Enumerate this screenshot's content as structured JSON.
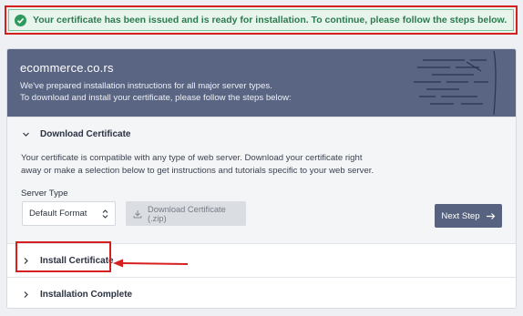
{
  "banner": {
    "message": "Your certificate has been issued and is ready for installation. To continue, please follow the steps below.",
    "icon": "check-circle-icon",
    "color": "#2f9a5d"
  },
  "header": {
    "domain": "ecommerce.co.rs",
    "line1": "We've prepared installation instructions for all major server types.",
    "line2": "To download and install your certificate, please follow the steps below:"
  },
  "download_section": {
    "title": "Download Certificate",
    "expanded": true,
    "description_line1": "Your certificate is compatible with any type of web server. Download your certificate right",
    "description_line2": "away or make a selection below to get instructions and tutorials specific to your web server.",
    "server_type_label": "Server Type",
    "server_type_value": "Default Format",
    "download_button": "Download Certificate (.zip)",
    "next_button": "Next Step"
  },
  "install_section": {
    "title": "Install Certificate",
    "expanded": false
  },
  "complete_section": {
    "title": "Installation Complete",
    "expanded": false
  },
  "colors": {
    "header_bg": "#5a6583",
    "accent": "#56627f",
    "annotation": "#d6201f"
  }
}
